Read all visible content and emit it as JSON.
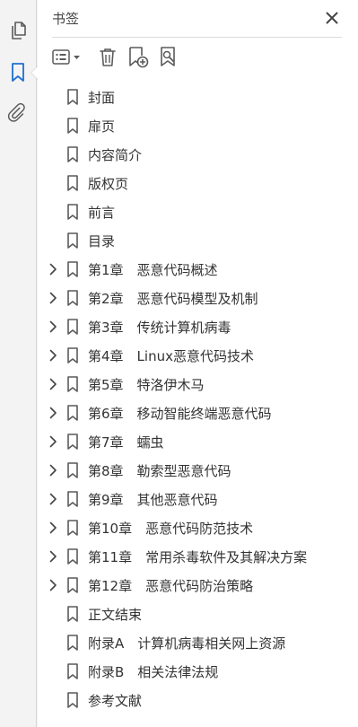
{
  "sidebar": {
    "items": [
      {
        "name": "pages-icon"
      },
      {
        "name": "bookmark-icon"
      },
      {
        "name": "attachment-icon"
      }
    ]
  },
  "panel": {
    "title": "书签",
    "close_icon": "close-icon"
  },
  "toolbar": {
    "options_icon": "options-list-icon",
    "delete_icon": "trash-icon",
    "new_bookmark_icon": "add-bookmark-icon",
    "find_icon": "find-bookmark-icon"
  },
  "bookmarks": [
    {
      "label": "封面",
      "expandable": false
    },
    {
      "label": "扉页",
      "expandable": false
    },
    {
      "label": "内容简介",
      "expandable": false
    },
    {
      "label": "版权页",
      "expandable": false
    },
    {
      "label": "前言",
      "expandable": false
    },
    {
      "label": "目录",
      "expandable": false
    },
    {
      "label": "第1章　恶意代码概述",
      "expandable": true
    },
    {
      "label": "第2章　恶意代码模型及机制",
      "expandable": true
    },
    {
      "label": "第3章　传统计算机病毒",
      "expandable": true
    },
    {
      "label": "第4章　Linux恶意代码技术",
      "expandable": true
    },
    {
      "label": "第5章　特洛伊木马",
      "expandable": true
    },
    {
      "label": "第6章　移动智能终端恶意代码",
      "expandable": true
    },
    {
      "label": "第7章　蠕虫",
      "expandable": true
    },
    {
      "label": "第8章　勒索型恶意代码",
      "expandable": true
    },
    {
      "label": "第9章　其他恶意代码",
      "expandable": true
    },
    {
      "label": "第10章　恶意代码防范技术",
      "expandable": true
    },
    {
      "label": "第11章　常用杀毒软件及其解决方案",
      "expandable": true
    },
    {
      "label": "第12章　恶意代码防治策略",
      "expandable": true
    },
    {
      "label": "正文结束",
      "expandable": false
    },
    {
      "label": "附录A　计算机病毒相关网上资源",
      "expandable": false
    },
    {
      "label": "附录B　相关法律法规",
      "expandable": false
    },
    {
      "label": "参考文献",
      "expandable": false
    }
  ],
  "colors": {
    "icon": "#5a5a5a",
    "active_icon": "#1f6fd1",
    "text": "#333333"
  }
}
